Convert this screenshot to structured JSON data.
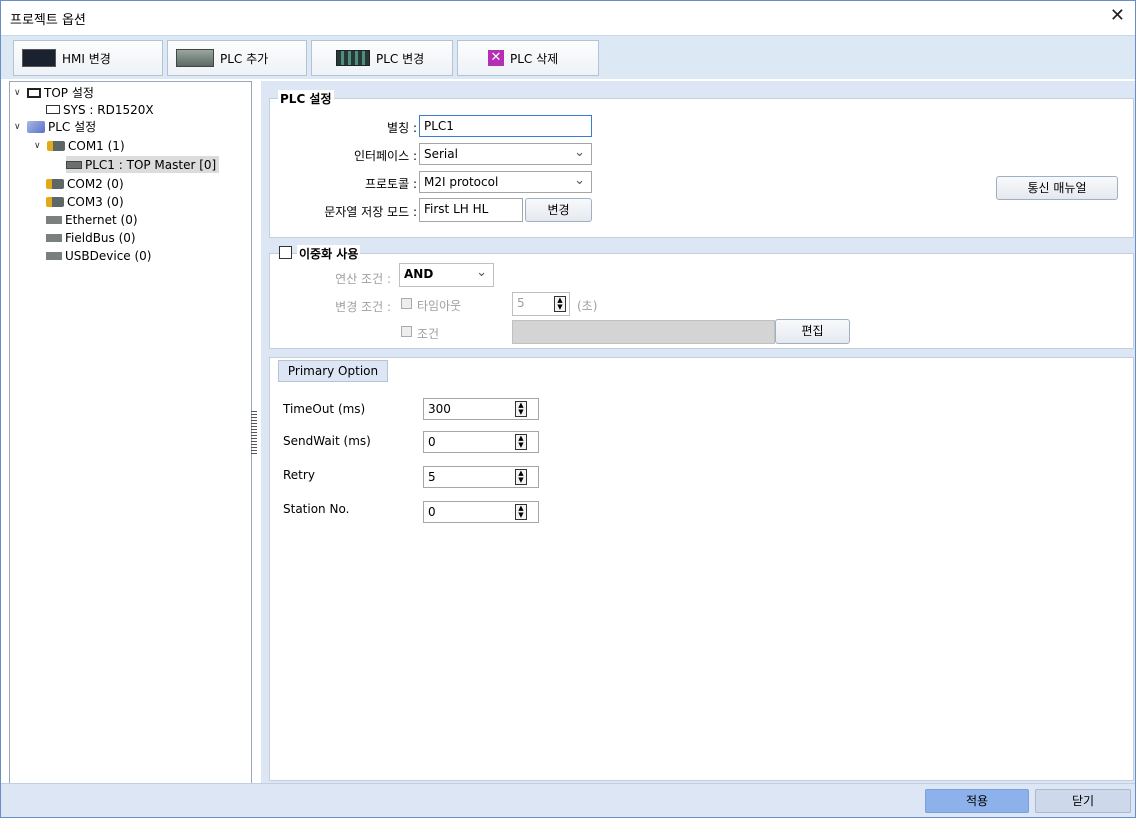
{
  "window": {
    "title": "프로젝트 옵션"
  },
  "toolbar": {
    "hmi_change": "HMI 변경",
    "plc_add": "PLC 추가",
    "plc_change": "PLC 변경",
    "plc_delete": "PLC 삭제"
  },
  "tree": {
    "top": "TOP 설정",
    "sys": "SYS : RD1520X",
    "plc": "PLC 설정",
    "com1": "COM1 (1)",
    "plc1": "PLC1 : TOP Master [0]",
    "com2": "COM2 (0)",
    "com3": "COM3 (0)",
    "ethernet": "Ethernet (0)",
    "fieldbus": "FieldBus (0)",
    "usb": "USBDevice (0)"
  },
  "plc_settings": {
    "group_title": "PLC 설정",
    "alias_label": "별칭 :",
    "alias_value": "PLC1",
    "interface_label": "인터페이스 :",
    "interface_value": "Serial",
    "protocol_label": "프로토콜 :",
    "protocol_value": "M2I protocol",
    "string_mode_label": "문자열 저장 모드 :",
    "string_mode_value": "First LH HL",
    "change_button": "변경",
    "manual_button": "통신 매뉴얼"
  },
  "redundancy": {
    "title": "이중화 사용",
    "operation_label": "연산 조건 :",
    "operation_value": "AND",
    "change_cond_label": "변경 조건 :",
    "timeout_label": "타임아웃",
    "timeout_value": "5",
    "timeout_unit": "(초)",
    "condition_label": "조건",
    "edit_button": "편집"
  },
  "primary_option": {
    "tab": "Primary Option",
    "fields": [
      {
        "label": "TimeOut (ms)",
        "value": "300"
      },
      {
        "label": "SendWait (ms)",
        "value": "0"
      },
      {
        "label": "Retry",
        "value": "5"
      },
      {
        "label": "Station No.",
        "value": "0"
      }
    ]
  },
  "footer": {
    "apply": "적용",
    "close": "닫기"
  },
  "colors": {
    "panel_bg": "#dce6f4",
    "accent": "#8db1ea",
    "border": "#6a8cc7"
  }
}
